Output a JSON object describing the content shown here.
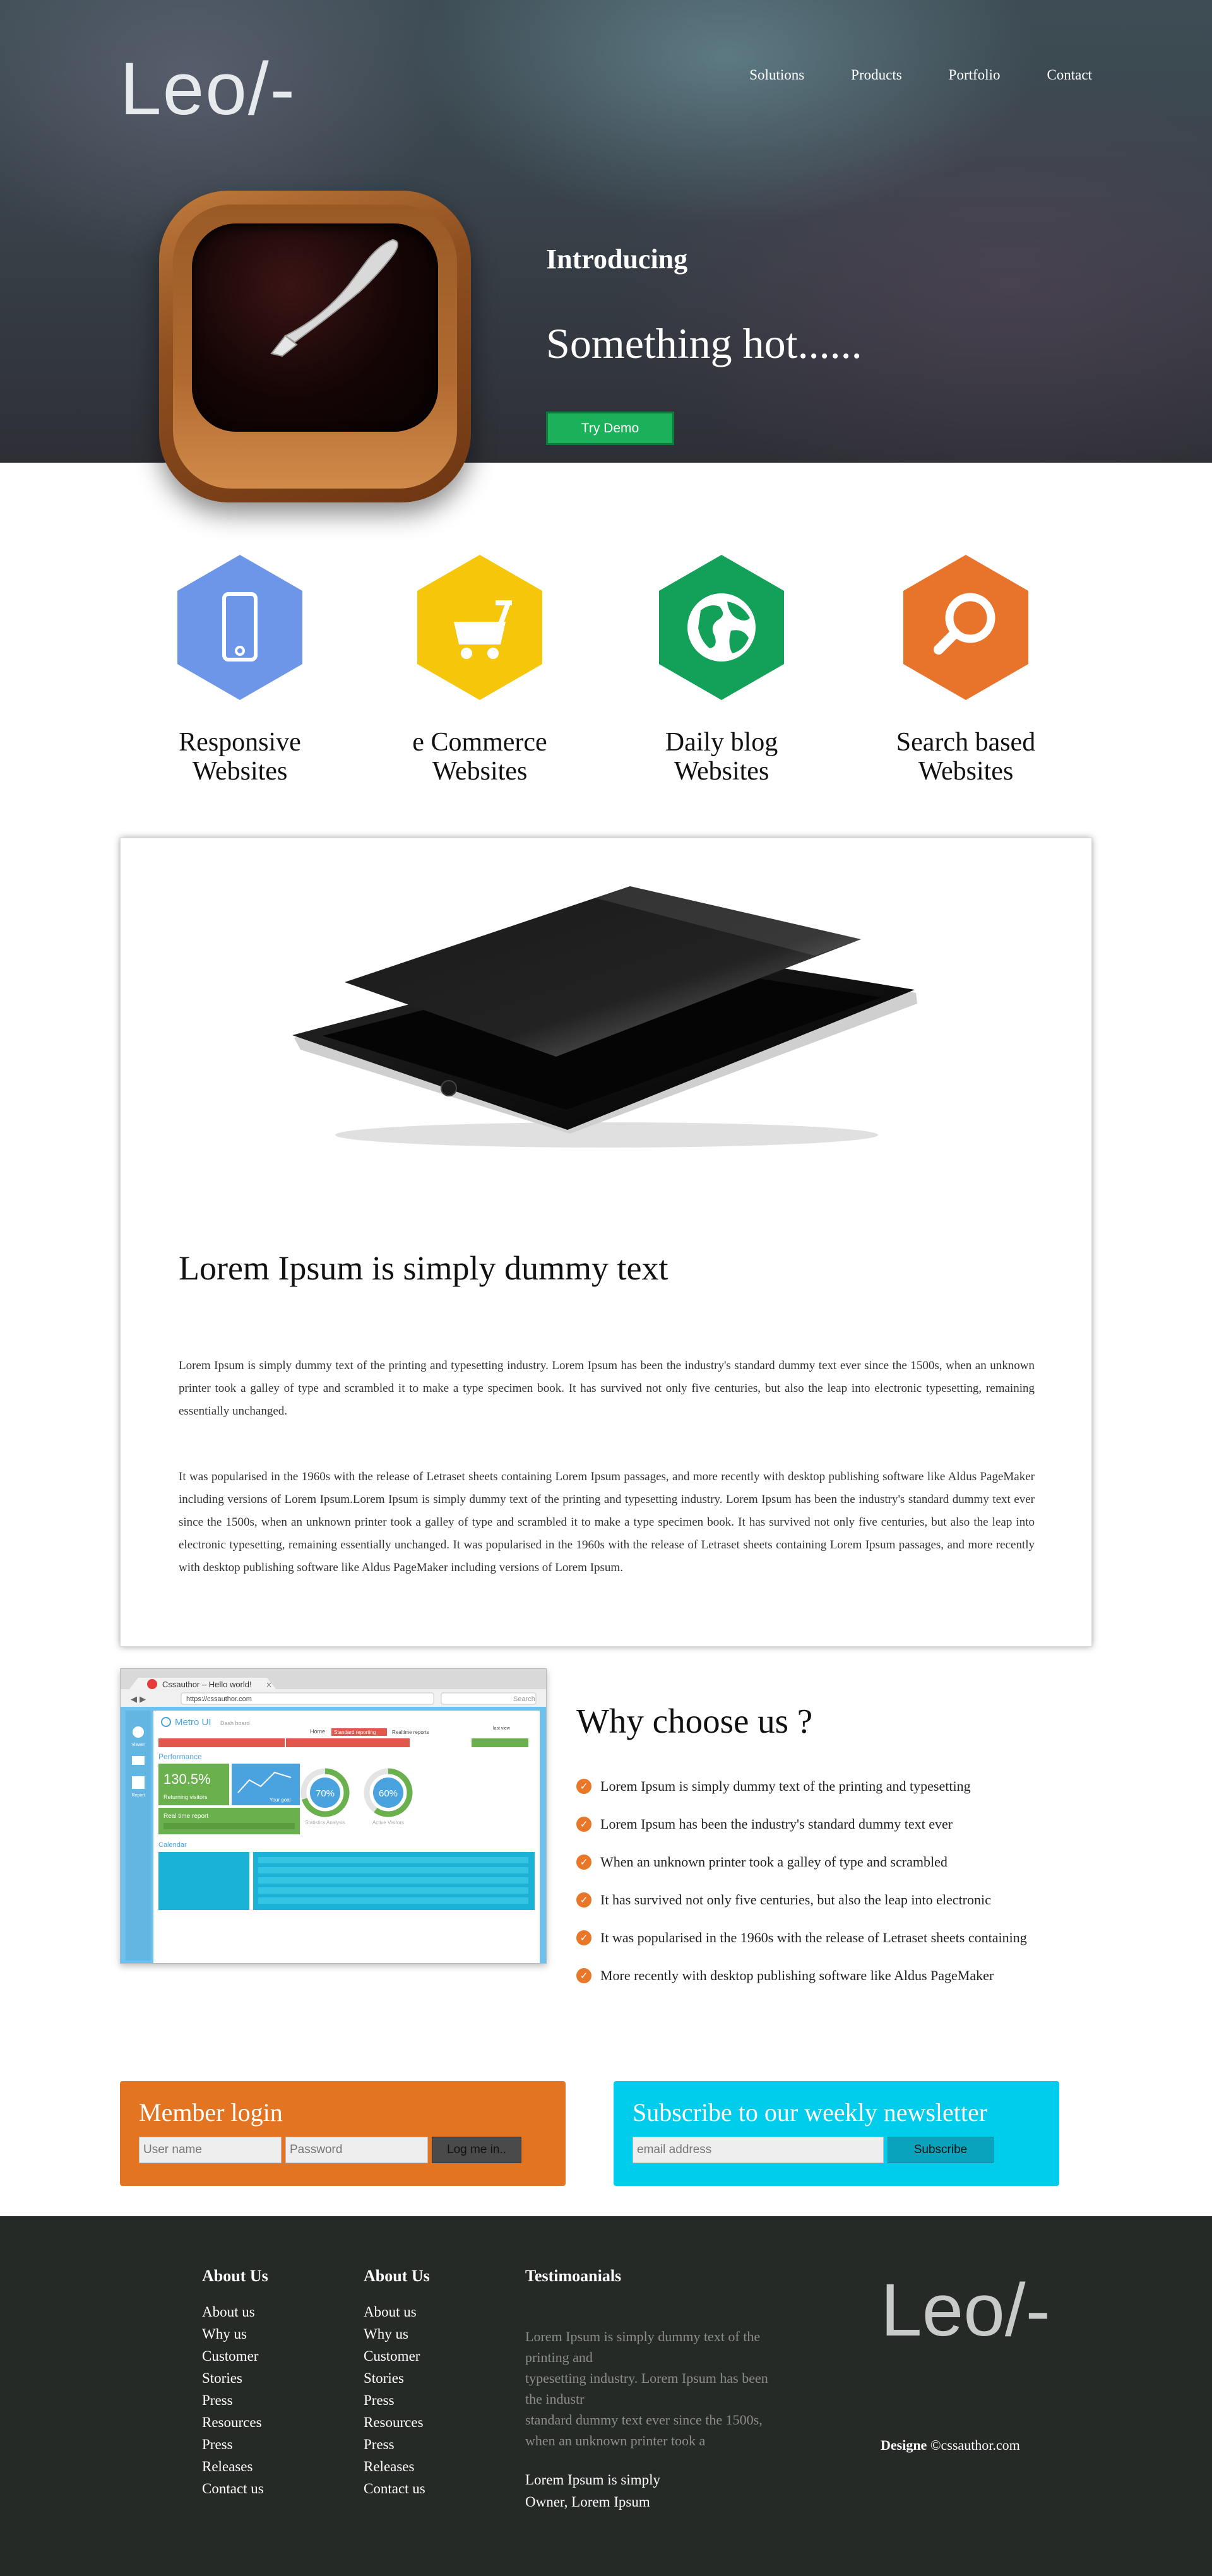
{
  "brand": {
    "logo": "Leo/-"
  },
  "nav": {
    "items": [
      "Solutions",
      "Products",
      "Portfolio",
      "Contact"
    ]
  },
  "hero": {
    "intro": "Introducing",
    "headline": "Something hot......",
    "demo_button": "Try Demo"
  },
  "features": [
    {
      "label_line1": "Responsive",
      "label_line2": "Websites",
      "icon": "mobile-phone-icon",
      "color": "#6d96e8"
    },
    {
      "label_line1": "e Commerce",
      "label_line2": "Websites",
      "icon": "shopping-cart-icon",
      "color": "#f5c60a"
    },
    {
      "label_line1": "Daily blog",
      "label_line2": "Websites",
      "icon": "globe-icon",
      "color": "#13a15a"
    },
    {
      "label_line1": "Search based",
      "label_line2": "Websites",
      "icon": "search-icon",
      "color": "#e8732a"
    }
  ],
  "article": {
    "title": "Lorem Ipsum is simply dummy text",
    "paragraph1": "Lorem Ipsum is simply dummy text of the printing and typesetting industry. Lorem Ipsum has been the industry's standard dummy text ever since the 1500s, when an unknown printer took a galley of type and scrambled it to make a type specimen book. It has survived not only five centuries, but also the leap into electronic typesetting, remaining essentially unchanged.",
    "paragraph2": "It was popularised in the 1960s with the release of Letraset sheets containing Lorem Ipsum passages, and more recently with desktop publishing software like Aldus PageMaker including versions of Lorem Ipsum.Lorem Ipsum is simply dummy text of the printing and typesetting industry. Lorem Ipsum has been the industry's standard dummy text ever since the 1500s, when an unknown printer took a galley of type and scrambled it to make a type specimen book. It has survived not only five centuries, but also the leap into electronic typesetting, remaining essentially unchanged. It was popularised in the 1960s with the release of Letraset sheets containing Lorem Ipsum passages, and more recently with desktop publishing software like Aldus PageMaker including versions of Lorem Ipsum."
  },
  "screenshot": {
    "tab_title": "Cssauthor – Hello world!",
    "url": "https://cssauthor.com",
    "search": "Search",
    "app_title": "Metro UI",
    "app_subtitle": "Dash board",
    "menu": [
      "Home",
      "Standard reporting",
      "Realtime reports",
      "last view"
    ],
    "section_title": "Performance",
    "stat_value": "130.5%",
    "stat_label": "Returning visitors",
    "stat2_label": "Your goal",
    "realtime_label": "Real time report",
    "gauge1_value": "70%",
    "gauge1_label": "Statistics Analysis",
    "gauge2_value": "60%",
    "gauge2_label": "Active Visitors",
    "calendar_label": "Calendar",
    "sidebar_labels": [
      "Viewer",
      "Report"
    ]
  },
  "why": {
    "title": "Why choose us ?",
    "items": [
      "Lorem Ipsum is simply dummy text of the printing and typesetting",
      "Lorem Ipsum has been the industry's standard dummy text ever",
      "When an unknown printer took a galley of type and scrambled",
      "It has survived not only five centuries, but also the leap into electronic",
      "It was popularised in the 1960s with the release of Letraset sheets containing",
      "More recently with desktop publishing software like Aldus PageMaker"
    ]
  },
  "login": {
    "title": "Member login",
    "username_placeholder": "User name",
    "password_placeholder": "Password",
    "button": "Log me in.."
  },
  "newsletter": {
    "title": "Subscribe to our weekly newsletter",
    "email_placeholder": "email address",
    "button": "Subscribe"
  },
  "footer": {
    "col1": {
      "title": "About Us",
      "items": [
        "About us",
        "Why us",
        "Customer",
        "Stories",
        "Press",
        "Resources",
        "Press",
        "Releases",
        "Contact us"
      ]
    },
    "col2": {
      "title": "About Us",
      "items": [
        "About us",
        "Why us",
        "Customer",
        "Stories",
        "Press",
        "Resources",
        "Press",
        "Releases",
        "Contact us"
      ]
    },
    "testimonials": {
      "title": "Testimoanials",
      "text_lines": [
        "Lorem Ipsum is simply dummy text of the",
        "printing and",
        "typesetting industry. Lorem Ipsum has been",
        "the industr",
        "standard dummy text ever since the 1500s,",
        "when an unknown printer took a"
      ],
      "sign_line1": "Lorem Ipsum is simply",
      "sign_line2": "Owner, Lorem Ipsum"
    },
    "logo": "Leo/-",
    "design_label": "Designe",
    "design_credit": "©cssauthor.com"
  }
}
